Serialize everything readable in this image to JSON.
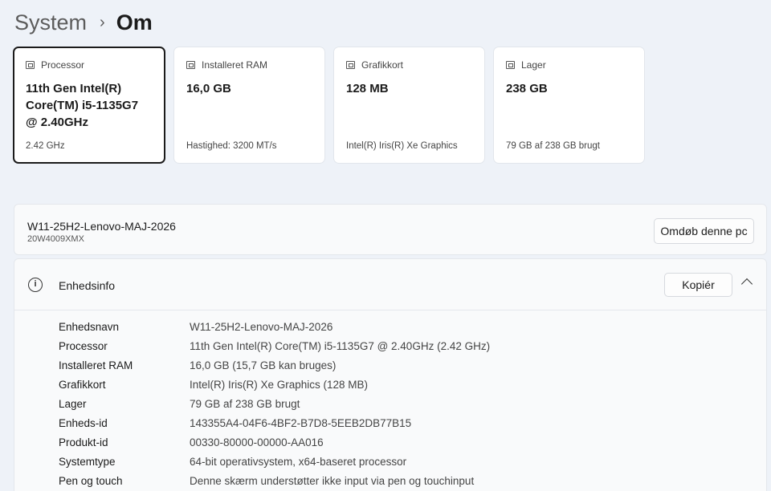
{
  "breadcrumb": {
    "parent": "System",
    "separator": "›",
    "current": "Om"
  },
  "cards": [
    {
      "id": "processor",
      "label": "Processor",
      "icon": "processor-icon",
      "value": "11th Gen Intel(R) Core(TM) i5-1135G7 @ 2.40GHz",
      "sub": "2.42 GHz",
      "selected": true
    },
    {
      "id": "ram",
      "label": "Installeret RAM",
      "icon": "ram-icon",
      "value": "16,0 GB",
      "sub": "Hastighed: 3200 MT/s"
    },
    {
      "id": "gpu",
      "label": "Grafikkort",
      "icon": "gpu-icon",
      "value": "128 MB",
      "sub": "Intel(R) Iris(R) Xe Graphics"
    },
    {
      "id": "storage",
      "label": "Lager",
      "icon": "storage-icon",
      "value": "238 GB",
      "sub": "79 GB af 238 GB brugt"
    }
  ],
  "pc": {
    "name": "W11-25H2-Lenovo-MAJ-2026",
    "model": "20W4009XMX",
    "rename_label": "Omdøb denne pc"
  },
  "device_info": {
    "title": "Enhedsinfo",
    "copy_label": "Kopiér",
    "specs": [
      {
        "key": "Enhedsnavn",
        "value": "W11-25H2-Lenovo-MAJ-2026"
      },
      {
        "key": "Processor",
        "value": "11th Gen Intel(R) Core(TM) i5-1135G7 @ 2.40GHz (2.42 GHz)"
      },
      {
        "key": "Installeret RAM",
        "value": "16,0 GB (15,7 GB kan bruges)"
      },
      {
        "key": "Grafikkort",
        "value": "Intel(R) Iris(R) Xe Graphics (128 MB)"
      },
      {
        "key": "Lager",
        "value": "79 GB af 238 GB brugt"
      },
      {
        "key": "Enheds-id",
        "value": "143355A4-04F6-4BF2-B7D8-5EEB2DB77B15"
      },
      {
        "key": "Produkt-id",
        "value": "00330-80000-00000-AA016"
      },
      {
        "key": "Systemtype",
        "value": "64-bit operativsystem, x64-baseret processor"
      },
      {
        "key": "Pen og touch",
        "value": "Denne skærm understøtter ikke input via pen og touchinput"
      }
    ]
  }
}
